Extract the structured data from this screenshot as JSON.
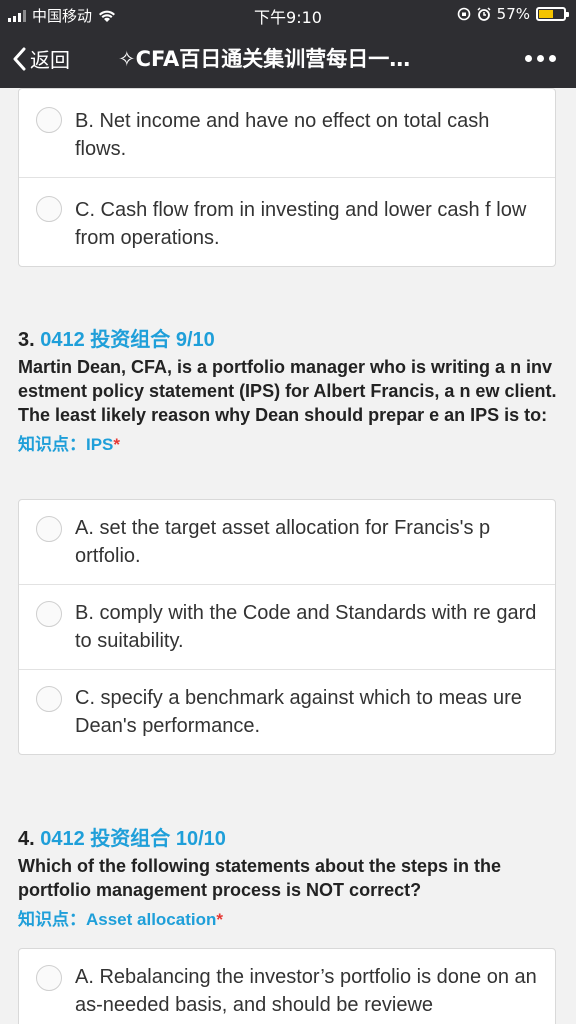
{
  "status_bar": {
    "carrier": "中国移动",
    "time": "下午9:10",
    "battery_text": "57%",
    "battery_level": 0.57
  },
  "nav": {
    "back_label": "返回",
    "title": "✧CFA百日通关集训营每日一…"
  },
  "questions": [
    {
      "options": [
        "B. Net income and have no effect on total cash flows.",
        "C. Cash flow from in investing and lower cash f low from operations."
      ]
    },
    {
      "number": "3.",
      "tag": "0412 投资组合 9/10",
      "text": "Martin Dean, CFA, is a portfolio manager who is writing a n investment policy statement (IPS) for Albert Francis, a n ew client. The least likely reason why Dean should prepar e an IPS is to:",
      "knowledge_label": "知识点：",
      "knowledge_value": "IPS",
      "required_mark": "*",
      "options": [
        "A. set the target asset allocation for Francis's p ortfolio.",
        "B. comply with the Code and Standards with re gard to suitability.",
        "C. specify a benchmark against which to meas ure Dean's performance."
      ]
    },
    {
      "number": "4.",
      "tag": "0412 投资组合 10/10",
      "text": "Which of the following statements about the steps in the portfolio management process is NOT correct?",
      "knowledge_label": "知识点：",
      "knowledge_value": "Asset allocation",
      "required_mark": "*",
      "options": [
        "A. Rebalancing the investor’s portfolio is done on an as-needed basis, and should be reviewe"
      ]
    }
  ]
}
